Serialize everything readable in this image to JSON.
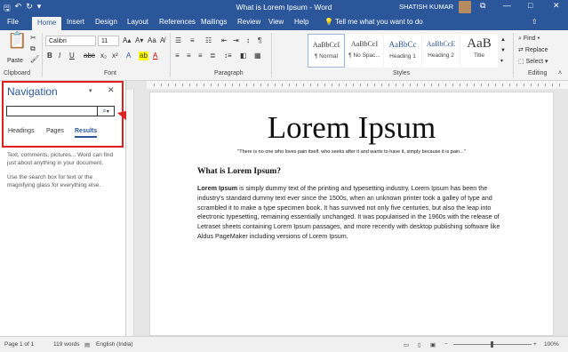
{
  "window": {
    "title": "What is Lorem Ipsum - Word",
    "user_name": "SHATISH KUMAR",
    "quick_access": [
      "save-icon",
      "undo-icon",
      "redo-icon",
      "customize-icon"
    ],
    "controls": {
      "minimize": "—",
      "maximize": "□",
      "close": "✕",
      "restore": "⧉"
    }
  },
  "ribbon": {
    "tabs": [
      "File",
      "Home",
      "Insert",
      "Design",
      "Layout",
      "References",
      "Mailings",
      "Review",
      "View",
      "Help"
    ],
    "active_tab": "Home",
    "tell_me": "Tell me what you want to do",
    "groups": {
      "clipboard": "Clipboard",
      "font": "Font",
      "paragraph": "Paragraph",
      "styles": "Styles",
      "editing": "Editing"
    },
    "paste_label": "Paste",
    "font_name": "Calibri",
    "font_size": "11",
    "styles": [
      {
        "preview": "AaBbCcI",
        "name": "¶ Normal"
      },
      {
        "preview": "AaBbCcI",
        "name": "¶ No Spac..."
      },
      {
        "preview": "AaBbCc",
        "name": "Heading 1"
      },
      {
        "preview": "AaBbCcE",
        "name": "Heading 2"
      },
      {
        "preview": "AaB",
        "name": "Title"
      }
    ],
    "editing": {
      "find": "Find",
      "replace": "Replace",
      "select": "Select"
    }
  },
  "navigation": {
    "title": "Navigation",
    "search_value": "",
    "tabs": [
      "Headings",
      "Pages",
      "Results"
    ],
    "active_tab": "Results",
    "help_1": "Text, comments, pictures... Word can find just about anything in your document.",
    "help_2": "Use the search box for text or the magnifying glass for everything else."
  },
  "document": {
    "title": "Lorem Ipsum",
    "quote": "\"There is no one who loves pain itself, who seeks after it and wants to have it, simply because it is pain...\"",
    "heading": "What is Lorem Ipsum?",
    "lead": "Lorem Ipsum",
    "body": " is simply dummy text of the printing and typesetting industry. Lorem Ipsum has been the industry's standard dummy text ever since the 1500s, when an unknown printer took a galley of type and scrambled it to make a type specimen book. It has survived not only five centuries, but also the leap into electronic typesetting, remaining essentially unchanged. It was popularised in the 1960s with the release of Letraset sheets containing Lorem Ipsum passages, and more recently with desktop publishing software like Aldus PageMaker including versions of Lorem Ipsum."
  },
  "status": {
    "page": "Page 1 of 1",
    "words": "119 words",
    "language": "English (India)",
    "zoom": "100%"
  },
  "colors": {
    "accent": "#2b579a",
    "highlight": "#e02020"
  }
}
